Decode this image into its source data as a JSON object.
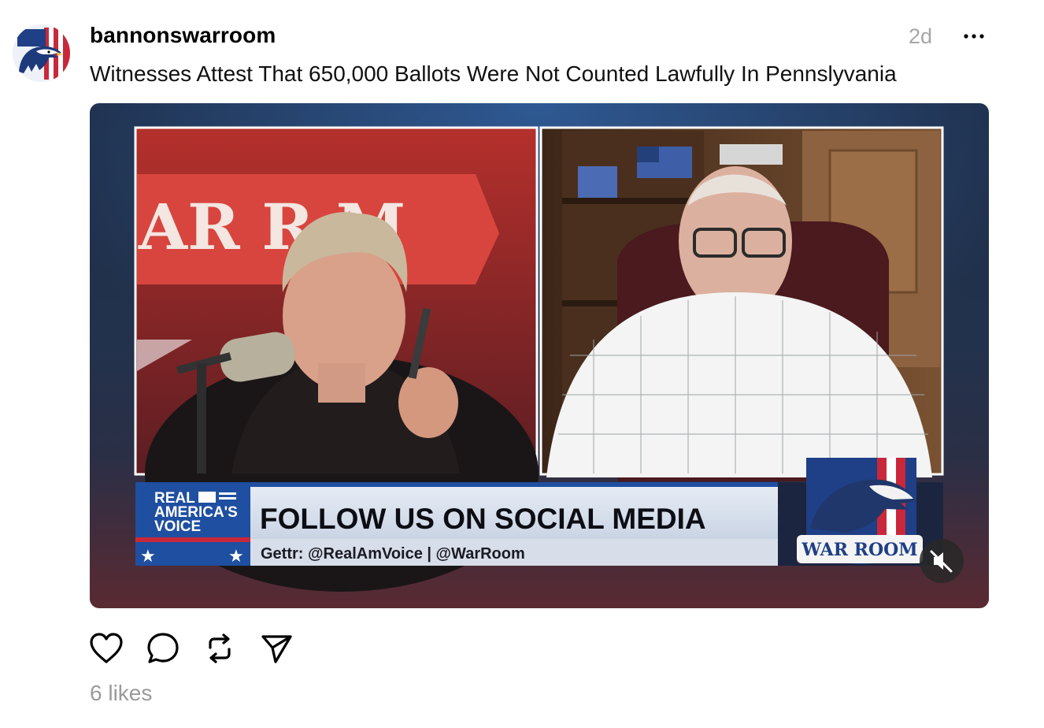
{
  "post": {
    "username": "bannonswarroom",
    "time": "2d",
    "caption": "Witnesses Attest That 650,000 Ballots Were Not Counted Lawfully In Pennslyvania",
    "likes": "6 likes"
  },
  "video": {
    "left_backdrop_sign": "AR R    M",
    "network_logo_lines": [
      "REAL",
      "AMERICA'S",
      "VOICE"
    ],
    "banner_headline": "FOLLOW US ON SOCIAL MEDIA",
    "banner_subline": "Gettr: @RealAmVoice | @WarRoom",
    "show_logo_text": "WAR ROOM",
    "muted": true
  },
  "icons": {
    "avatar": "eagle-flag-avatar",
    "more": "more-icon",
    "mute": "speaker-muted-icon",
    "like": "heart-icon",
    "comment": "comment-icon",
    "repost": "repost-icon",
    "share": "send-icon"
  },
  "colors": {
    "text": "#000000",
    "muted_text": "#a6a6a6",
    "banner_blue": "#1f4fa0",
    "banner_red": "#c8283a"
  }
}
